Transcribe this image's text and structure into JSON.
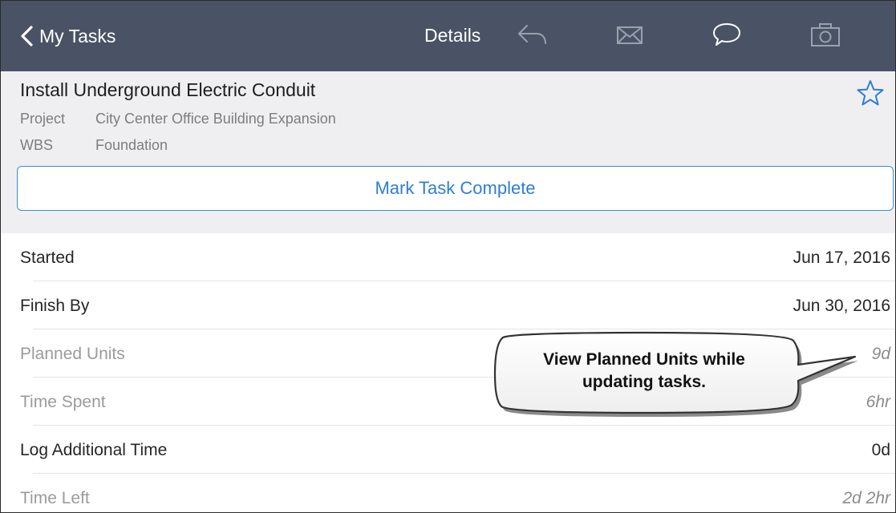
{
  "navbar": {
    "back_label": "My Tasks",
    "title": "Details",
    "icons": [
      "reply-icon",
      "mail-icon",
      "comment-icon",
      "camera-icon"
    ],
    "color": "#4a5366"
  },
  "task": {
    "title": "Install Underground Electric Conduit",
    "project_label": "Project",
    "project_value": "City Center Office Building Expansion",
    "wbs_label": "WBS",
    "wbs_value": "Foundation",
    "complete_button": "Mark Task Complete"
  },
  "rows": [
    {
      "label": "Started",
      "value": "Jun 17, 2016",
      "muted": false
    },
    {
      "label": "Finish By",
      "value": "Jun 30, 2016",
      "muted": false
    },
    {
      "label": "Planned Units",
      "value": "9d",
      "muted": true
    },
    {
      "label": "Time Spent",
      "value": "6hr",
      "muted": true
    },
    {
      "label": "Log Additional Time",
      "value": "0d",
      "muted": false
    },
    {
      "label": "Time Left",
      "value": "2d 2hr",
      "muted": true
    }
  ],
  "callout": {
    "line1": "View Planned Units while",
    "line2": "updating tasks."
  },
  "colors": {
    "accent": "#2e7fd0",
    "header_bg": "#efeff2"
  }
}
